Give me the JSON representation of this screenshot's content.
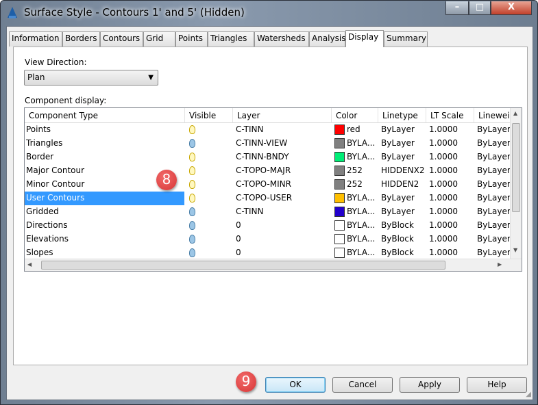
{
  "window": {
    "title": "Surface Style - Contours 1' and 5' (Hidden)",
    "minimize": "–",
    "maximize": "□",
    "close": "X"
  },
  "tabs": [
    {
      "label": "Information"
    },
    {
      "label": "Borders"
    },
    {
      "label": "Contours"
    },
    {
      "label": "Grid"
    },
    {
      "label": "Points"
    },
    {
      "label": "Triangles"
    },
    {
      "label": "Watersheds"
    },
    {
      "label": "Analysis"
    },
    {
      "label": "Display",
      "active": true
    },
    {
      "label": "Summary"
    }
  ],
  "view_direction": {
    "label": "View Direction:",
    "value": "Plan"
  },
  "component_display": {
    "label": "Component display:",
    "columns": [
      "Component Type",
      "Visible",
      "Layer",
      "Color",
      "Linetype",
      "LT Scale",
      "Linewei"
    ],
    "rows": [
      {
        "type": "Points",
        "visible": true,
        "layer": "C-TINN",
        "color_hex": "#ff0000",
        "color": "red",
        "linetype": "ByLayer",
        "lt_scale": "1.0000",
        "lineweight": "ByLayer"
      },
      {
        "type": "Triangles",
        "visible": false,
        "layer": "C-TINN-VIEW",
        "color_hex": "#808080",
        "color": "BYLA...",
        "linetype": "ByLayer",
        "lt_scale": "1.0000",
        "lineweight": "ByLayer"
      },
      {
        "type": "Border",
        "visible": true,
        "layer": "C-TINN-BNDY",
        "color_hex": "#00ee77",
        "color": "BYLA...",
        "linetype": "ByLayer",
        "lt_scale": "1.0000",
        "lineweight": "ByLayer"
      },
      {
        "type": "Major Contour",
        "visible": true,
        "layer": "C-TOPO-MAJR",
        "color_hex": "#808080",
        "color": "252",
        "linetype": "HIDDENX2",
        "lt_scale": "1.0000",
        "lineweight": "ByLayer"
      },
      {
        "type": "Minor Contour",
        "visible": true,
        "layer": "C-TOPO-MINR",
        "color_hex": "#808080",
        "color": "252",
        "linetype": "HIDDEN2",
        "lt_scale": "1.0000",
        "lineweight": "ByLayer"
      },
      {
        "type": "User Contours",
        "visible": true,
        "selected": true,
        "layer": "C-TOPO-USER",
        "color_hex": "#ffbf00",
        "color": "BYLA...",
        "linetype": "ByLayer",
        "lt_scale": "1.0000",
        "lineweight": "ByLayer"
      },
      {
        "type": "Gridded",
        "visible": false,
        "layer": "C-TINN",
        "color_hex": "#2200cc",
        "color": "BYLA...",
        "linetype": "ByLayer",
        "lt_scale": "1.0000",
        "lineweight": "ByLayer"
      },
      {
        "type": "Directions",
        "visible": false,
        "layer": "0",
        "color_hex": "#ffffff",
        "color": "BYLA...",
        "linetype": "ByBlock",
        "lt_scale": "1.0000",
        "lineweight": "ByLayer"
      },
      {
        "type": "Elevations",
        "visible": false,
        "layer": "0",
        "color_hex": "#ffffff",
        "color": "BYLA...",
        "linetype": "ByBlock",
        "lt_scale": "1.0000",
        "lineweight": "ByLayer"
      },
      {
        "type": "Slopes",
        "visible": false,
        "layer": "0",
        "color_hex": "#ffffff",
        "color": "BYLA...",
        "linetype": "ByBlock",
        "lt_scale": "1.0000",
        "lineweight": "ByLayer"
      }
    ]
  },
  "callouts": [
    "8",
    "9"
  ],
  "buttons": {
    "ok": "OK",
    "cancel": "Cancel",
    "apply": "Apply",
    "help": "Help"
  }
}
